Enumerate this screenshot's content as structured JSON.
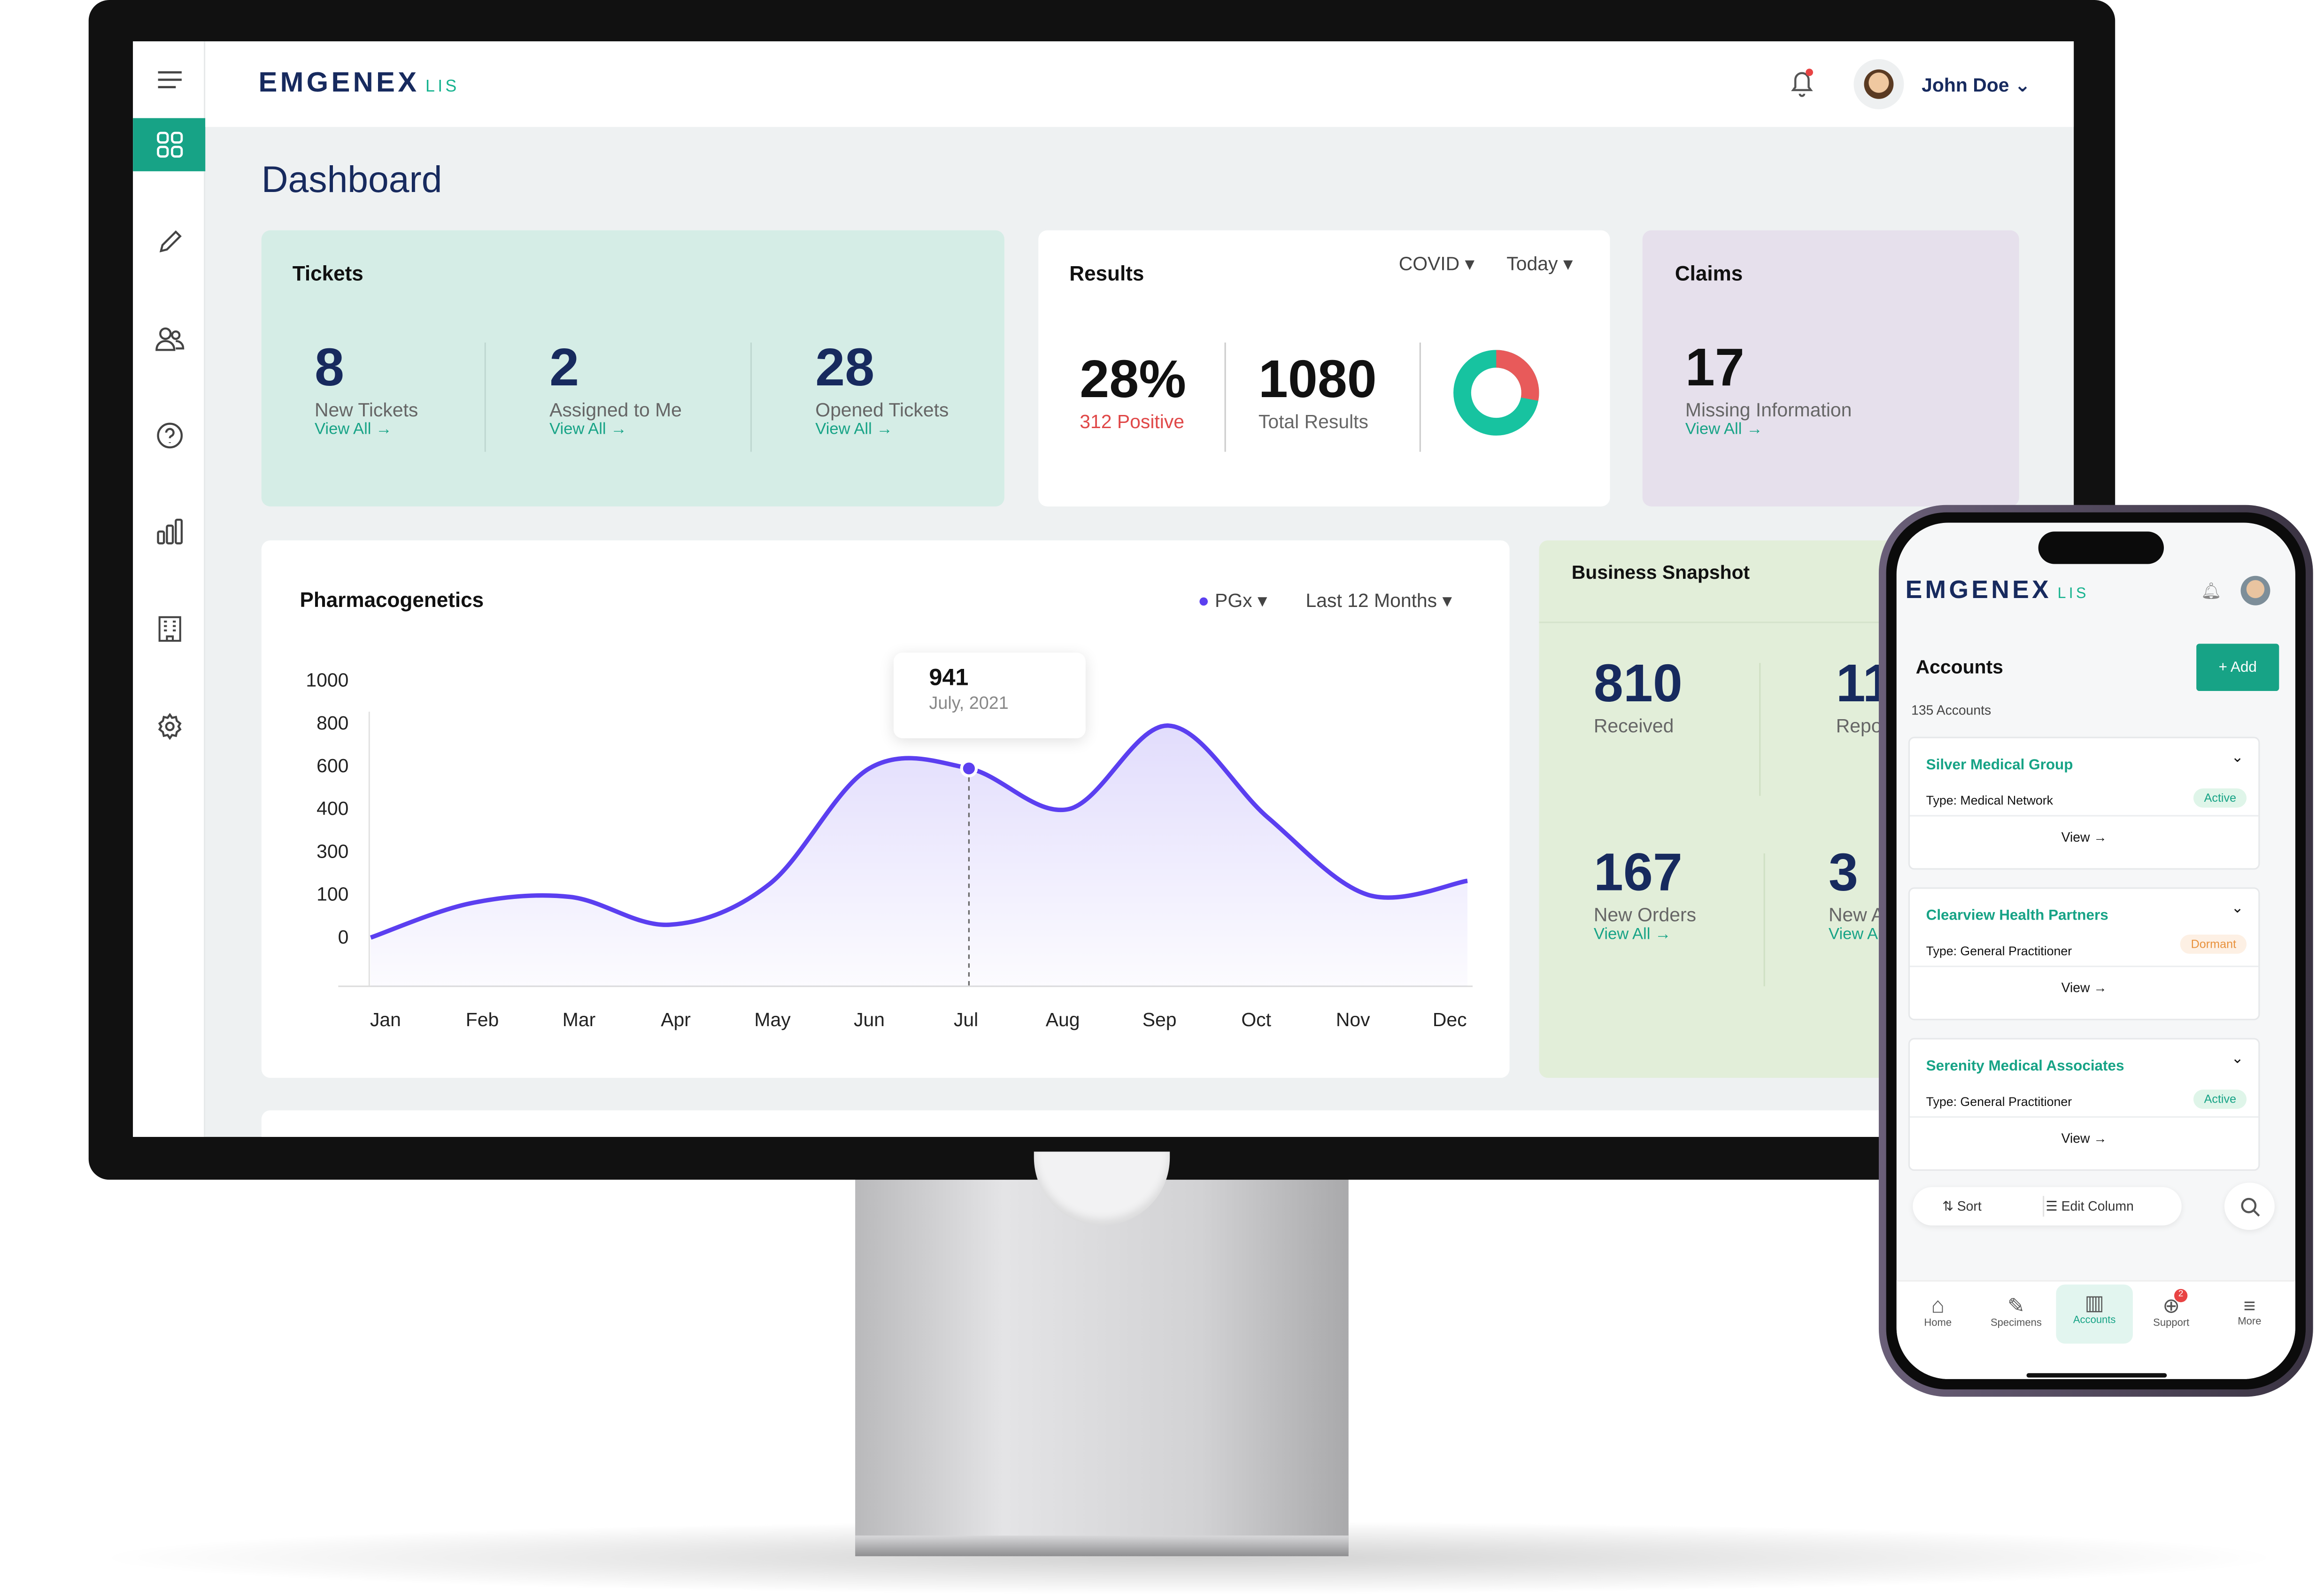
{
  "brand": {
    "name": "EMGENEX",
    "suffix": "LIS",
    "accent": "#17a386",
    "navy": "#172a5e"
  },
  "header": {
    "user": "John Doe",
    "icons": [
      "menu-icon",
      "bell-icon",
      "avatar",
      "chevron-down-icon"
    ]
  },
  "sidebar": {
    "items": [
      {
        "icon": "dashboard-grid-icon",
        "active": true
      },
      {
        "icon": "pen-icon"
      },
      {
        "icon": "users-icon"
      },
      {
        "icon": "help-icon"
      },
      {
        "icon": "bar-chart-icon"
      },
      {
        "icon": "building-icon"
      },
      {
        "icon": "gear-icon"
      }
    ]
  },
  "page": {
    "title": "Dashboard"
  },
  "tickets": {
    "title": "Tickets",
    "items": [
      {
        "value": "8",
        "label": "New Tickets",
        "link": "View All"
      },
      {
        "value": "2",
        "label": "Assigned to Me",
        "link": "View All"
      },
      {
        "value": "28",
        "label": "Opened Tickets",
        "link": "View All"
      }
    ]
  },
  "results": {
    "title": "Results",
    "filter1": "COVID",
    "filter2": "Today",
    "percent": "28%",
    "positive": "312 Positive",
    "total": "1080",
    "total_label": "Total Results",
    "donut": {
      "positive_fraction": 0.28,
      "colors": [
        "#e85a5a",
        "#17c3a0"
      ]
    }
  },
  "claims": {
    "title": "Claims",
    "value": "17",
    "label": "Missing Information",
    "link": "View All"
  },
  "chart_data": {
    "type": "area",
    "title": "Pharmacogenetics",
    "legend": "PGx",
    "range": "Last 12 Months",
    "categories": [
      "Jan",
      "Feb",
      "Mar",
      "Apr",
      "May",
      "Jun",
      "Jul",
      "Aug",
      "Sep",
      "Oct",
      "Nov",
      "Dec"
    ],
    "values": [
      0,
      80,
      95,
      30,
      150,
      590,
      590,
      400,
      790,
      380,
      100,
      165
    ],
    "yticks": [
      "1000",
      "800",
      "600",
      "400",
      "300",
      "100",
      "0"
    ],
    "tooltip": {
      "value": "941",
      "date": "July, 2021",
      "index": 6
    },
    "color": "#5b3ff0"
  },
  "snapshot": {
    "title": "Business Snapshot",
    "items": [
      {
        "value": "810",
        "label": "Received"
      },
      {
        "value": "11",
        "label": "Repo"
      },
      {
        "value": "167",
        "label": "New Orders",
        "link": "View All"
      },
      {
        "value": "3",
        "label": "New A",
        "link": "View A"
      }
    ]
  },
  "mobile": {
    "title": "Accounts",
    "add": "+ Add",
    "count": "135 Accounts",
    "accounts": [
      {
        "name": "Silver Medical Group",
        "type": "Type: Medical Network",
        "status": "Active",
        "view": "View"
      },
      {
        "name": "Clearview Health Partners",
        "type": "Type: General Practitioner",
        "status": "Dormant",
        "view": "View"
      },
      {
        "name": "Serenity Medical Associates",
        "type": "Type: General Practitioner",
        "status": "Active",
        "view": "View"
      }
    ],
    "sort": "Sort",
    "edit": "Edit Column",
    "tabs": [
      {
        "label": "Home",
        "icon": "home-icon"
      },
      {
        "label": "Specimens",
        "icon": "syringe-icon"
      },
      {
        "label": "Accounts",
        "icon": "building-icon",
        "active": true
      },
      {
        "label": "Support",
        "icon": "lifebuoy-icon",
        "badge": "2"
      },
      {
        "label": "More",
        "icon": "menu-icon"
      }
    ]
  }
}
